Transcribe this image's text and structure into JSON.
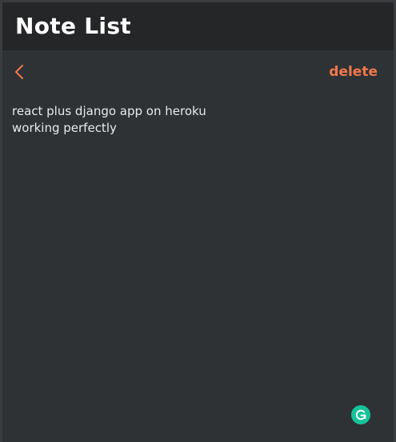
{
  "header": {
    "title": "Note List"
  },
  "toolbar": {
    "back_icon": "chevron-left-icon",
    "delete_label": "delete"
  },
  "note": {
    "body": "react plus django app on heroku\nworking perfectly"
  },
  "grammar_badge": {
    "icon": "grammarly-icon"
  },
  "colors": {
    "accent": "#f0784a",
    "background": "#2e3235",
    "header_background": "#252628",
    "text": "#e9e9e9",
    "badge": "#15c39a"
  }
}
